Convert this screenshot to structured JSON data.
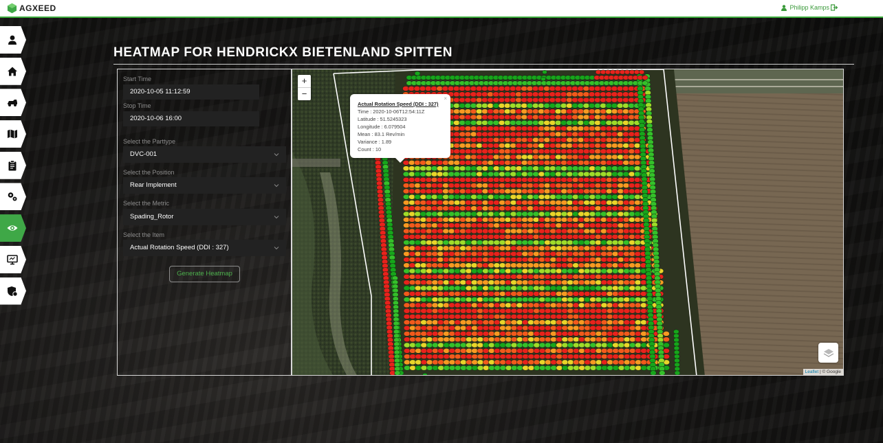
{
  "brand": {
    "name_prefix": "AG",
    "name_suffix": "XEED",
    "accent": "#3fa847"
  },
  "user": {
    "name": "Philipp Kamps"
  },
  "sidebar": {
    "items": [
      {
        "icon": "user-icon",
        "active": false
      },
      {
        "icon": "home-icon",
        "active": false
      },
      {
        "icon": "vehicle-icon",
        "active": false
      },
      {
        "icon": "map-icon",
        "active": false
      },
      {
        "icon": "clipboard-icon",
        "active": false
      },
      {
        "icon": "gears-icon",
        "active": false
      },
      {
        "icon": "eye-icon",
        "active": true
      },
      {
        "icon": "monitor-icon",
        "active": false
      },
      {
        "icon": "shield-icon",
        "active": false
      }
    ]
  },
  "page": {
    "title": "HEATMAP FOR HENDRICKX BIETENLAND SPITTEN"
  },
  "form": {
    "start_time_label": "Start Time",
    "start_time_value": "2020-10-05 11:12:59",
    "stop_time_label": "Stop Time",
    "stop_time_value": "2020-10-06 16:00",
    "parttype_label": "Select the Parttype",
    "parttype_value": "DVC-001",
    "position_label": "Select the Position",
    "position_value": "Rear Implement",
    "metric_label": "Select the Metric",
    "metric_value": "Spading_Rotor",
    "item_label": "Select the Item",
    "item_value": "Actual Rotation Speed (DDI : 327)",
    "generate_label": "Generate Heatmap"
  },
  "map": {
    "zoom_in": "+",
    "zoom_out": "−",
    "attribution_link": "Leaflet",
    "attribution_rest": " | © Google",
    "popup": {
      "title": "Actual Rotation Speed (DDI : 327)",
      "time": "Time : 2020-10-06T12:54:11Z",
      "latitude": "Latitude : 51.5245323",
      "longitude": "Longitude : 6.079504",
      "mean": "Mean : 83.1 Rev/min",
      "variance": "Variance : 1.89",
      "count": "Count : 10",
      "close": "×"
    },
    "heat_colors": [
      "#e8221c",
      "#f25a1c",
      "#f79a22",
      "#e9d52a",
      "#9fdc2a",
      "#35c02a",
      "#17a51b"
    ]
  }
}
